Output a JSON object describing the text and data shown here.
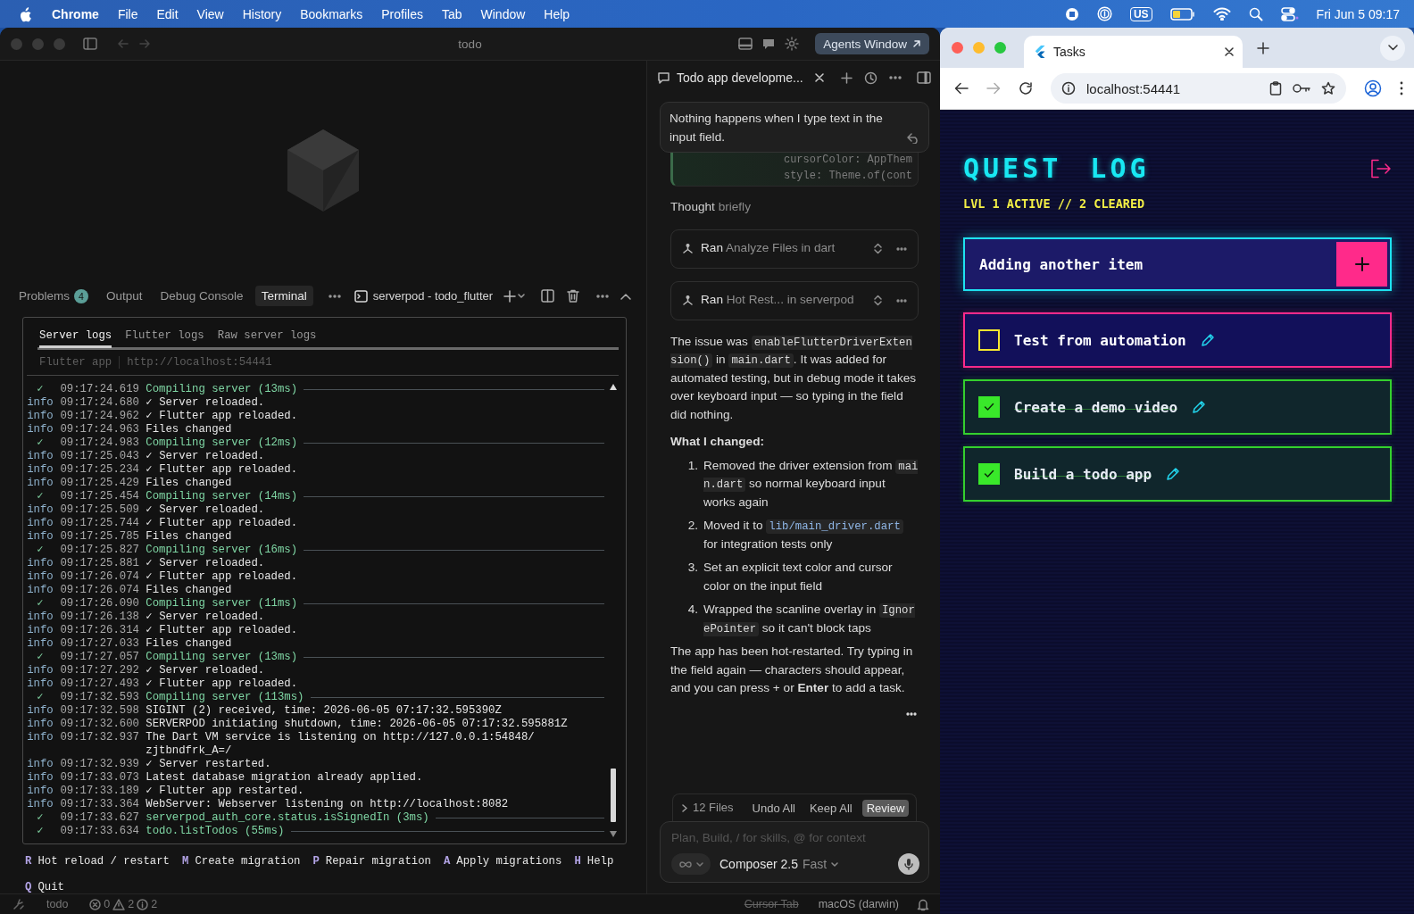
{
  "menu_bar": {
    "app": "Chrome",
    "menus": [
      "File",
      "Edit",
      "View",
      "History",
      "Bookmarks",
      "Profiles",
      "Tab",
      "Window",
      "Help"
    ],
    "input_source": "US",
    "clock": "Fri Jun 5 09:17"
  },
  "ide": {
    "title": "todo",
    "agents_button": "Agents Window",
    "panel_tabs": [
      {
        "label": "Problems",
        "badge": "4",
        "selected": false
      },
      {
        "label": "Output",
        "selected": false
      },
      {
        "label": "Debug Console",
        "selected": false
      },
      {
        "label": "Terminal",
        "selected": true
      }
    ],
    "terminal_name": "serverpod - todo_flutter",
    "terminal": {
      "tabs": [
        {
          "label": "Server logs",
          "selected": true
        },
        {
          "label": "Flutter logs",
          "selected": false
        },
        {
          "label": "Raw server logs",
          "selected": false
        }
      ],
      "source_label": "Flutter app",
      "source_url": "http://localhost:54441",
      "lines": [
        {
          "kind": "step",
          "tag": "✓",
          "time": "09:17:24.619",
          "text": "Compiling server (13ms)"
        },
        {
          "kind": "info",
          "tag": "info",
          "time": "09:17:24.680",
          "text": "✓ Server reloaded."
        },
        {
          "kind": "info",
          "tag": "info",
          "time": "09:17:24.962",
          "text": "✓ Flutter app reloaded."
        },
        {
          "kind": "info",
          "tag": "info",
          "time": "09:17:24.963",
          "text": "Files changed"
        },
        {
          "kind": "step",
          "tag": "✓",
          "time": "09:17:24.983",
          "text": "Compiling server (12ms)"
        },
        {
          "kind": "info",
          "tag": "info",
          "time": "09:17:25.043",
          "text": "✓ Server reloaded."
        },
        {
          "kind": "info",
          "tag": "info",
          "time": "09:17:25.234",
          "text": "✓ Flutter app reloaded."
        },
        {
          "kind": "info",
          "tag": "info",
          "time": "09:17:25.429",
          "text": "Files changed"
        },
        {
          "kind": "step",
          "tag": "✓",
          "time": "09:17:25.454",
          "text": "Compiling server (14ms)"
        },
        {
          "kind": "info",
          "tag": "info",
          "time": "09:17:25.509",
          "text": "✓ Server reloaded."
        },
        {
          "kind": "info",
          "tag": "info",
          "time": "09:17:25.744",
          "text": "✓ Flutter app reloaded."
        },
        {
          "kind": "info",
          "tag": "info",
          "time": "09:17:25.785",
          "text": "Files changed"
        },
        {
          "kind": "step",
          "tag": "✓",
          "time": "09:17:25.827",
          "text": "Compiling server (16ms)"
        },
        {
          "kind": "info",
          "tag": "info",
          "time": "09:17:25.881",
          "text": "✓ Server reloaded."
        },
        {
          "kind": "info",
          "tag": "info",
          "time": "09:17:26.074",
          "text": "✓ Flutter app reloaded."
        },
        {
          "kind": "info",
          "tag": "info",
          "time": "09:17:26.074",
          "text": "Files changed"
        },
        {
          "kind": "step",
          "tag": "✓",
          "time": "09:17:26.090",
          "text": "Compiling server (11ms)"
        },
        {
          "kind": "info",
          "tag": "info",
          "time": "09:17:26.138",
          "text": "✓ Server reloaded."
        },
        {
          "kind": "info",
          "tag": "info",
          "time": "09:17:26.314",
          "text": "✓ Flutter app reloaded."
        },
        {
          "kind": "info",
          "tag": "info",
          "time": "09:17:27.033",
          "text": "Files changed"
        },
        {
          "kind": "step",
          "tag": "✓",
          "time": "09:17:27.057",
          "text": "Compiling server (13ms)"
        },
        {
          "kind": "info",
          "tag": "info",
          "time": "09:17:27.292",
          "text": "✓ Server reloaded."
        },
        {
          "kind": "info",
          "tag": "info",
          "time": "09:17:27.493",
          "text": "✓ Flutter app reloaded."
        },
        {
          "kind": "step",
          "tag": "✓",
          "time": "09:17:32.593",
          "text": "Compiling server (113ms)"
        },
        {
          "kind": "info",
          "tag": "info",
          "time": "09:17:32.598",
          "text": "SIGINT (2) received, time: 2026-06-05 07:17:32.595390Z"
        },
        {
          "kind": "info",
          "tag": "info",
          "time": "09:17:32.600",
          "text": "SERVERPOD initiating shutdown, time: 2026-06-05 07:17:32.595881Z"
        },
        {
          "kind": "info",
          "tag": "info",
          "time": "09:17:32.937",
          "text": "The Dart VM service is listening on http://127.0.0.1:54848/\nzjtbndfrk_A=/"
        },
        {
          "kind": "info",
          "tag": "info",
          "time": "09:17:32.939",
          "text": "✓ Server restarted."
        },
        {
          "kind": "info",
          "tag": "info",
          "time": "09:17:33.073",
          "text": "Latest database migration already applied."
        },
        {
          "kind": "info",
          "tag": "info",
          "time": "09:17:33.189",
          "text": "✓ Flutter app restarted."
        },
        {
          "kind": "info",
          "tag": "info",
          "time": "09:17:33.364",
          "text": "WebServer: Webserver listening on http://localhost:8082"
        },
        {
          "kind": "step",
          "tag": "✓",
          "time": "09:17:33.627",
          "text": "serverpod_auth_core.status.isSignedIn (3ms)"
        },
        {
          "kind": "step",
          "tag": "✓",
          "time": "09:17:33.634",
          "text": "todo.listTodos (55ms)"
        }
      ]
    },
    "shortcuts": [
      {
        "key": "R",
        "label": "Hot reload / restart"
      },
      {
        "key": "M",
        "label": "Create migration"
      },
      {
        "key": "P",
        "label": "Repair migration"
      },
      {
        "key": "A",
        "label": "Apply migrations"
      },
      {
        "key": "H",
        "label": "Help"
      },
      {
        "key": "Q",
        "label": "Quit"
      }
    ],
    "status_bar": {
      "workspace": "todo",
      "errors": "0",
      "warnings": "2",
      "infos": "2",
      "cursor_tab": {
        "label": "Cursor Tab",
        "disabled": true
      },
      "platform": "macOS (darwin)"
    }
  },
  "agent": {
    "tab_title": "Todo app developme...",
    "user_message": "Nothing happens when I type text in the input field.",
    "code_peek": [
      "cursorColor: AppThem",
      "style: Theme.of(cont"
    ],
    "thought": {
      "label": "Thought",
      "detail": "briefly"
    },
    "tool_calls": [
      {
        "verb": "Ran",
        "detail": "Analyze Files in dart"
      },
      {
        "verb": "Ran",
        "detail": "Hot Rest... in serverpod"
      }
    ],
    "response": [
      {
        "kind": "paragraph",
        "segments": [
          {
            "kind": "text",
            "text": "The issue was "
          },
          {
            "kind": "code",
            "text": "enableFlutterDriverExtension()"
          },
          {
            "kind": "text",
            "text": " in "
          },
          {
            "kind": "code",
            "text": "main.dart"
          },
          {
            "kind": "text",
            "text": ". It was added for automated testing, but in debug mode it takes over keyboard input — so typing in the field did nothing."
          }
        ]
      },
      {
        "kind": "heading",
        "text": "What I changed:"
      },
      {
        "kind": "list_item",
        "number": "1.",
        "segments": [
          {
            "kind": "text",
            "text": "Removed the driver extension from "
          },
          {
            "kind": "code",
            "text": "main.dart"
          },
          {
            "kind": "text",
            "text": " so normal keyboard input works again"
          }
        ]
      },
      {
        "kind": "list_item",
        "number": "2.",
        "segments": [
          {
            "kind": "text",
            "text": "Moved it to "
          },
          {
            "kind": "path",
            "text": "lib/main_driver.dart"
          },
          {
            "kind": "text",
            "text": " for integration tests only"
          }
        ]
      },
      {
        "kind": "list_item",
        "number": "3.",
        "segments": [
          {
            "kind": "text",
            "text": "Set an explicit text color and cursor color on the input field"
          }
        ]
      },
      {
        "kind": "list_item",
        "number": "4.",
        "segments": [
          {
            "kind": "text",
            "text": "Wrapped the scanline overlay in "
          },
          {
            "kind": "code",
            "text": "IgnorePointer"
          },
          {
            "kind": "text",
            "text": " so it can't block taps"
          }
        ]
      },
      {
        "kind": "paragraph",
        "segments": [
          {
            "kind": "text",
            "text": "The app has been hot-restarted. Try typing in the field again — characters should appear, and you can press + or "
          },
          {
            "kind": "bold",
            "text": "Enter"
          },
          {
            "kind": "text",
            "text": " to add a task."
          }
        ]
      }
    ],
    "changes": {
      "files": "12 Files",
      "actions": [
        {
          "label": "Undo All",
          "selected": false
        },
        {
          "label": "Keep All",
          "selected": false
        },
        {
          "label": "Review",
          "selected": true
        }
      ]
    },
    "composer": {
      "placeholder": "Plan, Build, / for skills, @ for context",
      "model": "Composer 2.5",
      "speed": "Fast"
    }
  },
  "browser": {
    "tab_title": "Tasks",
    "url": "localhost:54441",
    "app": {
      "title": "QUEST LOG",
      "stats": "LVL 1 ACTIVE // 2 CLEARED",
      "input_value": "Adding another item",
      "todos": [
        {
          "title": "Test from automation",
          "checked": false
        },
        {
          "title": "Create a demo video",
          "checked": true
        },
        {
          "title": "Build a todo app",
          "checked": true
        }
      ]
    }
  }
}
